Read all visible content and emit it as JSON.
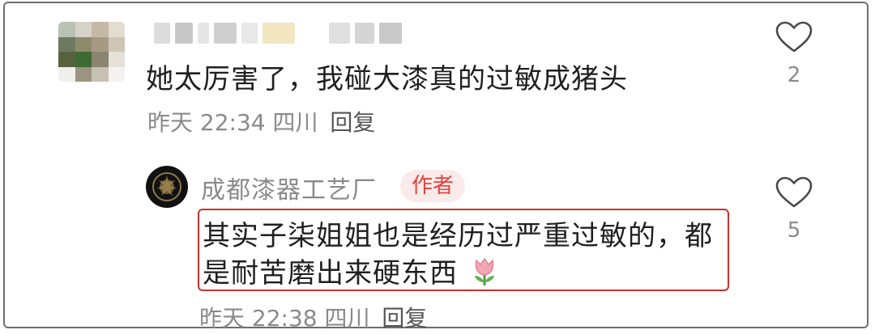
{
  "comment": {
    "text": "她太厉害了，我碰大漆真的过敏成猪头",
    "time": "昨天 22:34",
    "location": "四川",
    "reply_label": "回复",
    "likes": "2"
  },
  "reply": {
    "username": "成都漆器工艺厂",
    "author_tag": "作者",
    "text_line1": "其实子柒姐姐也是经历过严重过敏的，都",
    "text_line2": "是耐苦磨出来硬东西",
    "time": "昨天 22:38",
    "location": "四川",
    "reply_label": "回复",
    "likes": "5"
  },
  "colors": {
    "highlight_border": "#c8322c",
    "author_tag_bg": "#fbeaea",
    "author_tag_text": "#e2423f",
    "meta_text": "#8a8a8a"
  }
}
